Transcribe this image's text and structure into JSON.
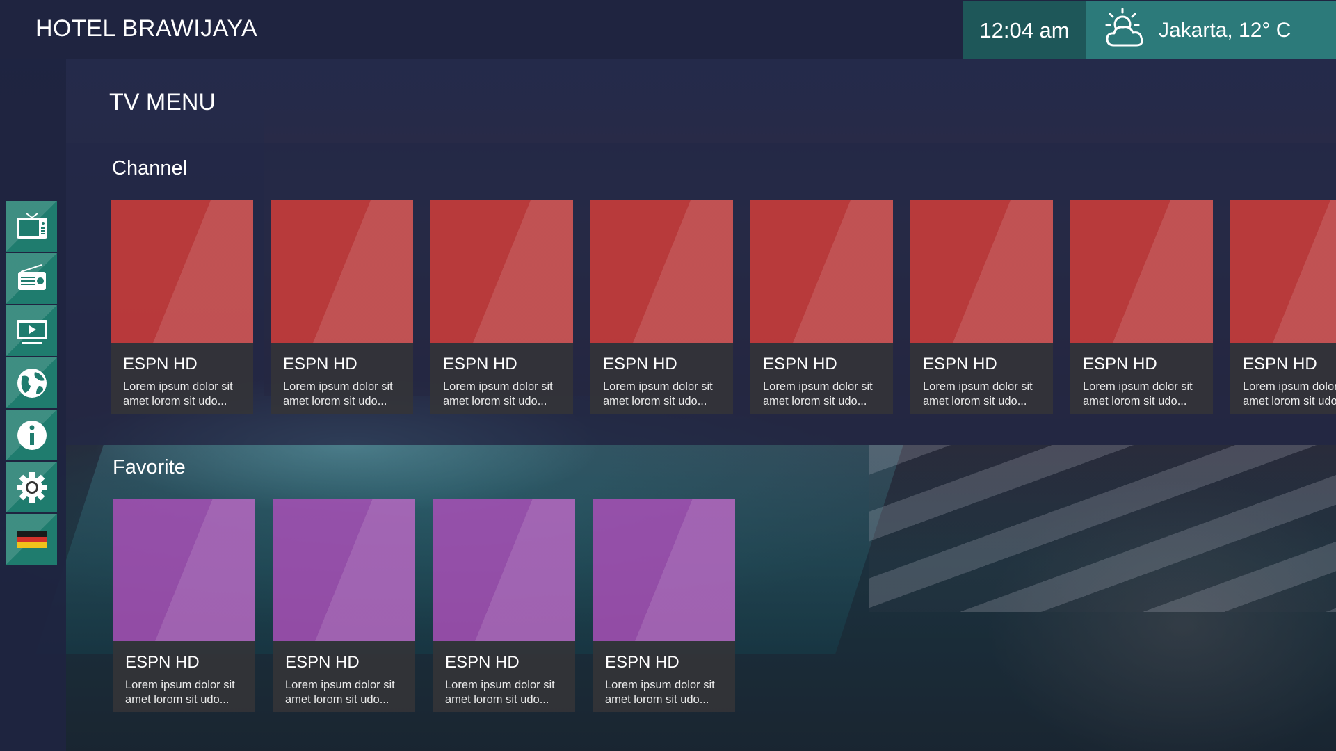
{
  "header": {
    "hotel_name": "HOTEL BRAWIJAYA",
    "time": "12:04 am",
    "weather": {
      "text": "Jakarta, 12° C",
      "icon": "partly-cloudy-icon"
    }
  },
  "page_title": "TV MENU",
  "sidebar": {
    "items": [
      {
        "name": "tv",
        "icon": "tv-icon"
      },
      {
        "name": "radio",
        "icon": "radio-icon"
      },
      {
        "name": "video",
        "icon": "video-icon"
      },
      {
        "name": "internet",
        "icon": "globe-icon"
      },
      {
        "name": "info",
        "icon": "info-icon"
      },
      {
        "name": "settings",
        "icon": "gear-icon"
      },
      {
        "name": "language",
        "icon": "german-flag-icon"
      }
    ]
  },
  "channel": {
    "label": "Channel",
    "cards": [
      {
        "name": "ESPN HD",
        "desc": "Lorem ipsum dolor sit amet lorom sit udo..."
      },
      {
        "name": "ESPN HD",
        "desc": "Lorem ipsum dolor sit amet lorom sit udo..."
      },
      {
        "name": "ESPN HD",
        "desc": "Lorem ipsum dolor sit amet lorom sit udo..."
      },
      {
        "name": "ESPN HD",
        "desc": "Lorem ipsum dolor sit amet lorom sit udo..."
      },
      {
        "name": "ESPN HD",
        "desc": "Lorem ipsum dolor sit amet lorom sit udo..."
      },
      {
        "name": "ESPN HD",
        "desc": "Lorem ipsum dolor sit amet lorom sit udo..."
      },
      {
        "name": "ESPN HD",
        "desc": "Lorem ipsum dolor sit amet lorom sit udo..."
      },
      {
        "name": "ESPN HD",
        "desc": "Lorem ipsum dolor sit amet lorom sit udo..."
      }
    ]
  },
  "favorite": {
    "label": "Favorite",
    "cards": [
      {
        "name": "ESPN HD",
        "desc": "Lorem ipsum dolor sit amet lorom sit udo..."
      },
      {
        "name": "ESPN HD",
        "desc": "Lorem ipsum dolor sit amet lorom sit udo..."
      },
      {
        "name": "ESPN HD",
        "desc": "Lorem ipsum dolor sit amet lorom sit udo..."
      },
      {
        "name": "ESPN HD",
        "desc": "Lorem ipsum dolor sit amet lorom sit udo..."
      }
    ]
  },
  "colors": {
    "header_bg": "#1f2440",
    "clock_bg": "#1e5759",
    "weather_bg": "#2c7a7a",
    "nav_bg": "#1f7c6e",
    "channel_thumb": "#cd3c3a",
    "favorite_thumb": "#a850b6"
  }
}
